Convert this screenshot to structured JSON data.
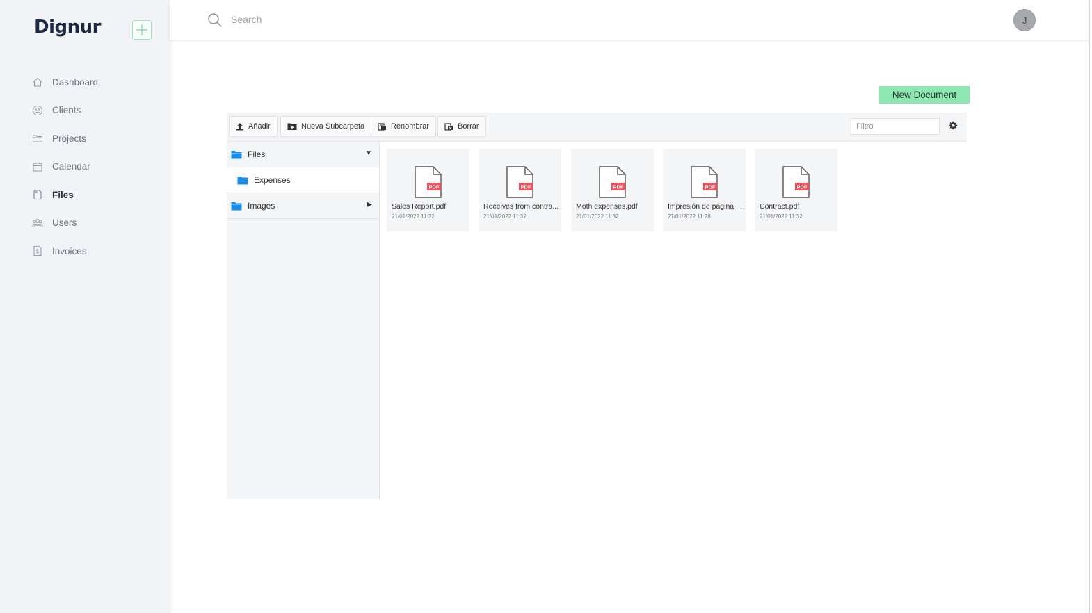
{
  "brand": {
    "name": "Dignur"
  },
  "sidebar": {
    "items": [
      {
        "label": "Dashboard",
        "icon": "home-icon"
      },
      {
        "label": "Clients",
        "icon": "user-circle-icon"
      },
      {
        "label": "Projects",
        "icon": "folder-icon"
      },
      {
        "label": "Calendar",
        "icon": "calendar-icon"
      },
      {
        "label": "Files",
        "icon": "file-icon",
        "active": true
      },
      {
        "label": "Users",
        "icon": "users-icon"
      },
      {
        "label": "Invoices",
        "icon": "invoice-icon"
      }
    ]
  },
  "topbar": {
    "search_placeholder": "Search",
    "avatar_initial": "J"
  },
  "actions": {
    "new_document": "New Document"
  },
  "toolbar": {
    "add": "Añadir",
    "new_subfolder": "Nueva Subcarpeta",
    "rename": "Renombrar",
    "delete": "Borrar",
    "filter_placeholder": "Filtro"
  },
  "tree": {
    "root": {
      "label": "Files",
      "expanded": true
    },
    "child": {
      "label": "Expenses"
    },
    "sibling": {
      "label": "Images",
      "expanded": false
    }
  },
  "files": [
    {
      "name": "Sales Report.pdf",
      "date": "21/01/2022 11:32",
      "badge": "PDF"
    },
    {
      "name": "Receives from contra...",
      "date": "21/01/2022 11:32",
      "badge": "PDF"
    },
    {
      "name": "Moth expenses.pdf",
      "date": "21/01/2022 11:32",
      "badge": "PDF"
    },
    {
      "name": "Impresión de página ...",
      "date": "21/01/2022 11:28",
      "badge": "PDF"
    },
    {
      "name": "Contract.pdf",
      "date": "21/01/2022 11:32",
      "badge": "PDF"
    }
  ],
  "colors": {
    "accent_green": "#8ee6b1",
    "sidebar_bg": "#f1f3f6",
    "folder_blue": "#1a8ce6",
    "pdf_red": "#f0505a"
  }
}
